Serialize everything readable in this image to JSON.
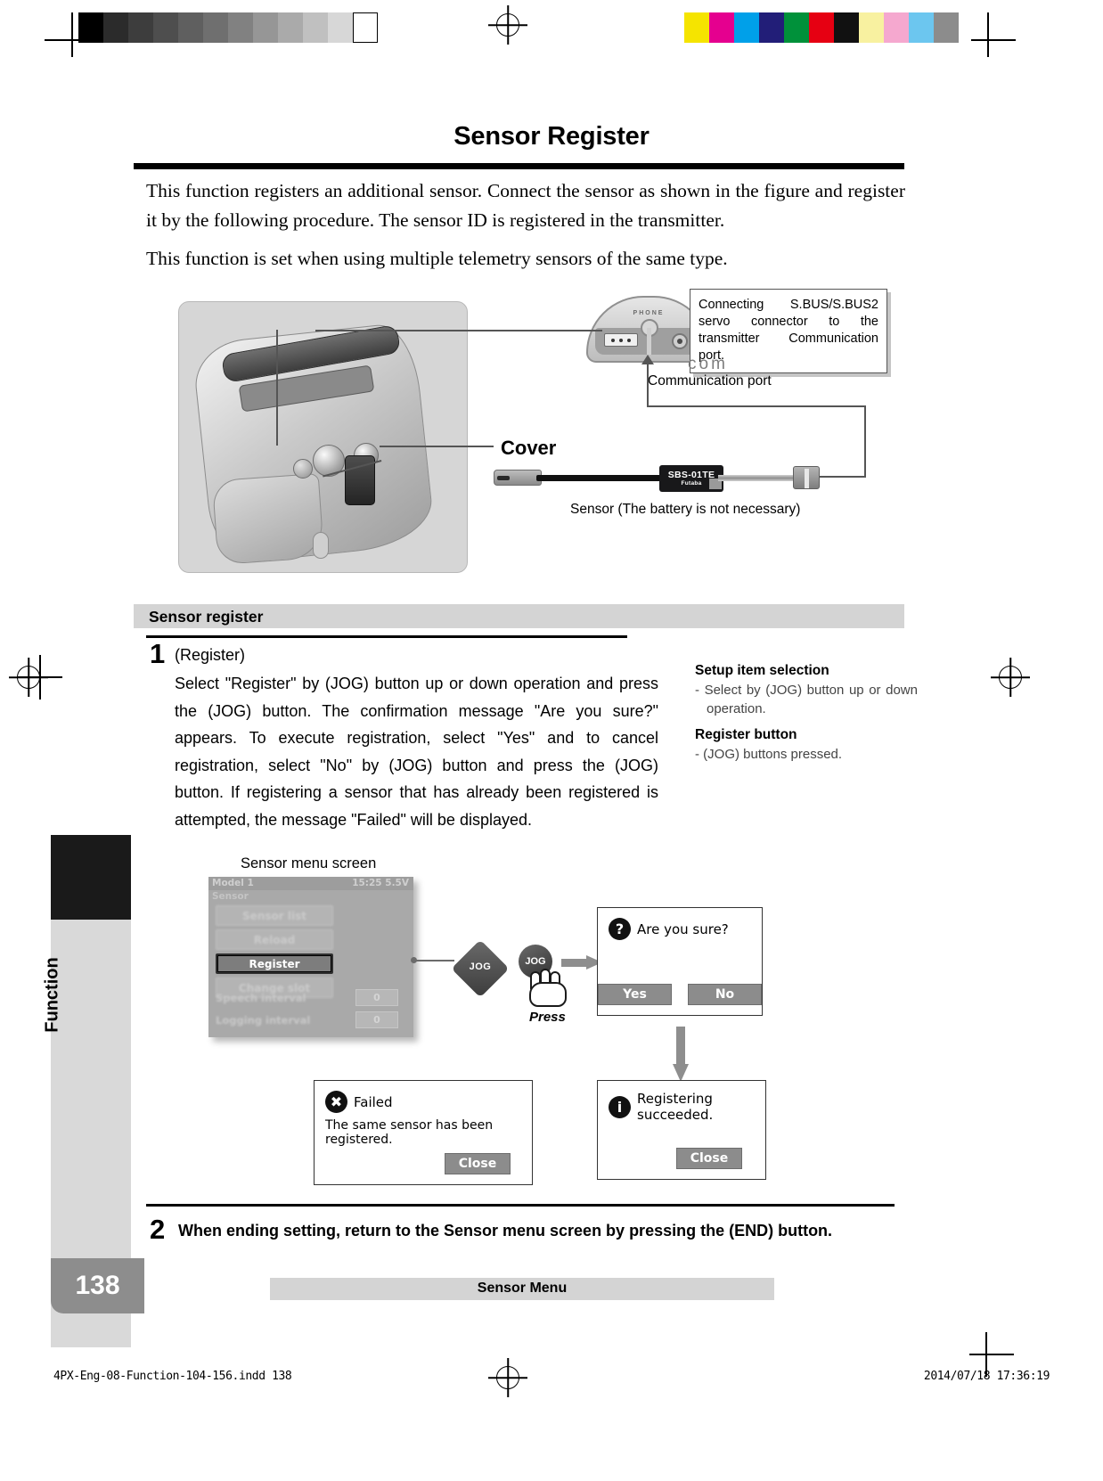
{
  "header": {
    "title": "Sensor Register",
    "intro_paragraph_1": "This function registers an additional sensor. Connect the sensor as shown in the figure and register it by the following procedure. The sensor ID is registered in the transmitter.",
    "intro_paragraph_2": "This function is set when using multiple telemetry sensors of the same type."
  },
  "figure": {
    "callout_text": "Connecting S.BUS/S.BUS2 servo connector to the transmitter Communication port.",
    "com_logo": "com",
    "communication_port_label": "Communication port",
    "cover_label": "Cover",
    "sensor_caption": "Sensor (The battery is not necessary)",
    "phone_label": "PHONE",
    "sensor_model": "SBS-01TE",
    "sensor_brand": "Futaba"
  },
  "section": {
    "band_title": "Sensor register"
  },
  "step1": {
    "number": "1",
    "heading": "(Register)",
    "body": "Select \"Register\" by (JOG) button up or down operation and press the (JOG) button. The confirmation message \"Are you sure?\" appears. To execute registration, select \"Yes\" and to cancel registration, select \"No\" by (JOG) button and press the (JOG) button. If registering a sensor that has already been registered is attempted, the message \"Failed\" will be displayed."
  },
  "side_notes": [
    {
      "heading": "Setup item selection",
      "text": "- Select by (JOG) button up or down operation."
    },
    {
      "heading": "Register button",
      "text": "- (JOG) buttons pressed."
    }
  ],
  "lcd": {
    "caption": "Sensor menu screen",
    "model": "Model 1",
    "status": "15:25 5.5V",
    "screen_title": "Sensor",
    "menu_items": [
      {
        "label": "Sensor list",
        "selected": false
      },
      {
        "label": "Reload",
        "selected": false
      },
      {
        "label": "Register",
        "selected": true
      },
      {
        "label": "Change slot",
        "selected": false
      }
    ],
    "settings": [
      {
        "label": "Speech interval",
        "value": "0"
      },
      {
        "label": "Logging interval",
        "value": "0"
      }
    ]
  },
  "controls": {
    "jog_pad_label": "JOG",
    "jog_button_label": "JOG",
    "press_label": "Press"
  },
  "dialogs": {
    "confirm": {
      "icon": "question-icon",
      "icon_glyph": "?",
      "title": "Are you sure?",
      "yes_label": "Yes",
      "no_label": "No"
    },
    "failed": {
      "icon": "error-icon",
      "icon_glyph": "✖",
      "title": "Failed",
      "message": "The same sensor has been registered.",
      "close_label": "Close"
    },
    "success": {
      "icon": "info-icon",
      "icon_glyph": "i",
      "title": "Registering succeeded.",
      "close_label": "Close"
    }
  },
  "step2": {
    "number": "2",
    "body": "When ending setting, return to the Sensor menu screen by pressing the (END) button."
  },
  "footer": {
    "tab_label": "Function",
    "page_number": "138",
    "band_label": "Sensor Menu",
    "slug_left": "4PX-Eng-08-Function-104-156.indd   138",
    "slug_right": "2014/07/18   17:36:19"
  },
  "colors": {
    "band_gray": "#d4d4d4",
    "tab_black": "#1a1a1a",
    "page_gray": "#8d8d8d"
  }
}
